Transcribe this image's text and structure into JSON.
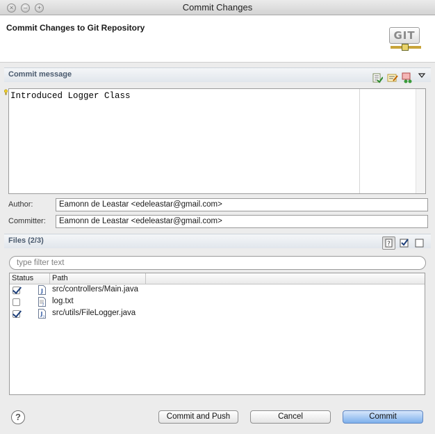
{
  "window": {
    "title": "Commit Changes"
  },
  "header": {
    "title": "Commit Changes to Git Repository",
    "logo_text": "GIT"
  },
  "commit_message": {
    "section_title": "Commit message",
    "text": "Introduced Logger Class",
    "toolbar_icons": [
      "spell-check-icon",
      "signed-off-icon",
      "change-id-icon",
      "dropdown-arrow-icon"
    ]
  },
  "author": {
    "label": "Author:",
    "value": "Eamonn de Leastar <edeleastar@gmail.com>"
  },
  "committer": {
    "label": "Committer:",
    "value": "Eamonn de Leastar <edeleastar@gmail.com>"
  },
  "files": {
    "section_title": "Files (2/3)",
    "filter_placeholder": "type filter text",
    "columns": [
      "Status",
      "Path"
    ],
    "rows": [
      {
        "checked": true,
        "icon": "java-file-icon",
        "path": "src/controllers/Main.java"
      },
      {
        "checked": false,
        "icon": "text-file-icon",
        "path": "log.txt"
      },
      {
        "checked": true,
        "icon": "java-file-icon",
        "path": "src/utils/FileLogger.java"
      }
    ],
    "toolbar_icons": [
      "show-untracked-icon",
      "select-all-icon",
      "deselect-all-icon"
    ]
  },
  "buttons": {
    "help": "?",
    "commit_and_push": "Commit and Push",
    "cancel": "Cancel",
    "commit": "Commit"
  }
}
